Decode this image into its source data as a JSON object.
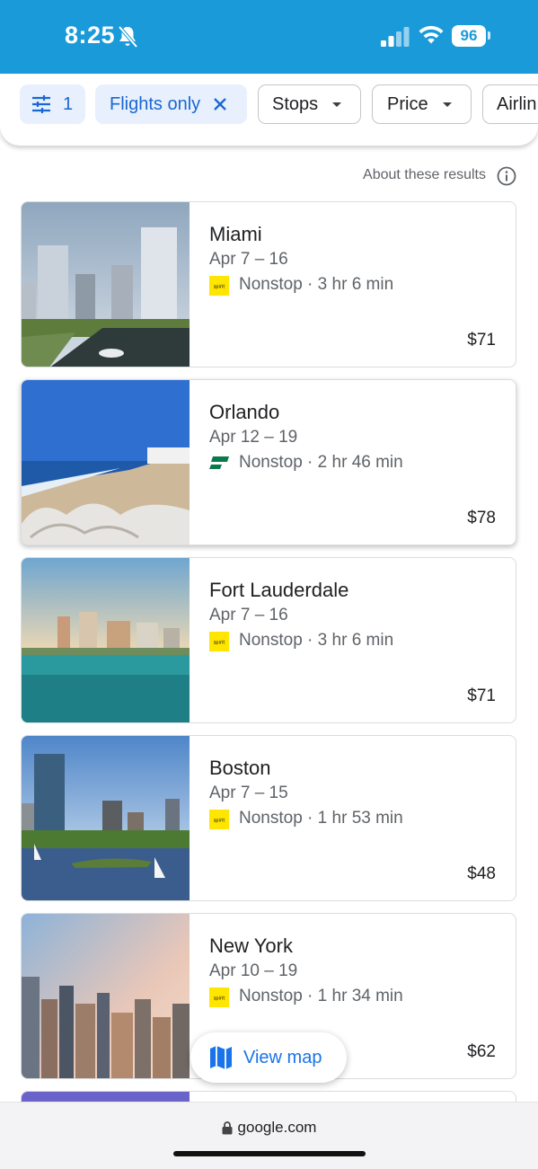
{
  "status_bar": {
    "time": "8:25",
    "battery": "96",
    "background_color": "#1a9ad9",
    "icons": [
      "bell-off-icon",
      "signal-icon",
      "wifi-icon",
      "battery-icon"
    ]
  },
  "filters": {
    "all_filters_count": "1",
    "flights_only_label": "Flights only",
    "stops_label": "Stops",
    "price_label": "Price",
    "airlines_label": "Airlin",
    "accent_color": "#1967d2"
  },
  "about_results": "About these results",
  "results": [
    {
      "city": "Miami",
      "dates": "Apr 7 – 16",
      "airline_logo": "spirit",
      "stops": "Nonstop",
      "duration": "3 hr 6 min",
      "price": "$71"
    },
    {
      "city": "Orlando",
      "dates": "Apr 12 – 19",
      "airline_logo": "frontier",
      "stops": "Nonstop",
      "duration": "2 hr 46 min",
      "price": "$78"
    },
    {
      "city": "Fort Lauderdale",
      "dates": "Apr 7 – 16",
      "airline_logo": "spirit",
      "stops": "Nonstop",
      "duration": "3 hr 6 min",
      "price": "$71"
    },
    {
      "city": "Boston",
      "dates": "Apr 7 – 15",
      "airline_logo": "spirit",
      "stops": "Nonstop",
      "duration": "1 hr 53 min",
      "price": "$48"
    },
    {
      "city": "New York",
      "dates": "Apr 10 – 19",
      "airline_logo": "spirit",
      "stops": "Nonstop",
      "duration": "1 hr 34 min",
      "price": "$62"
    }
  ],
  "view_map_label": "View map",
  "browser": {
    "url": "google.com"
  }
}
